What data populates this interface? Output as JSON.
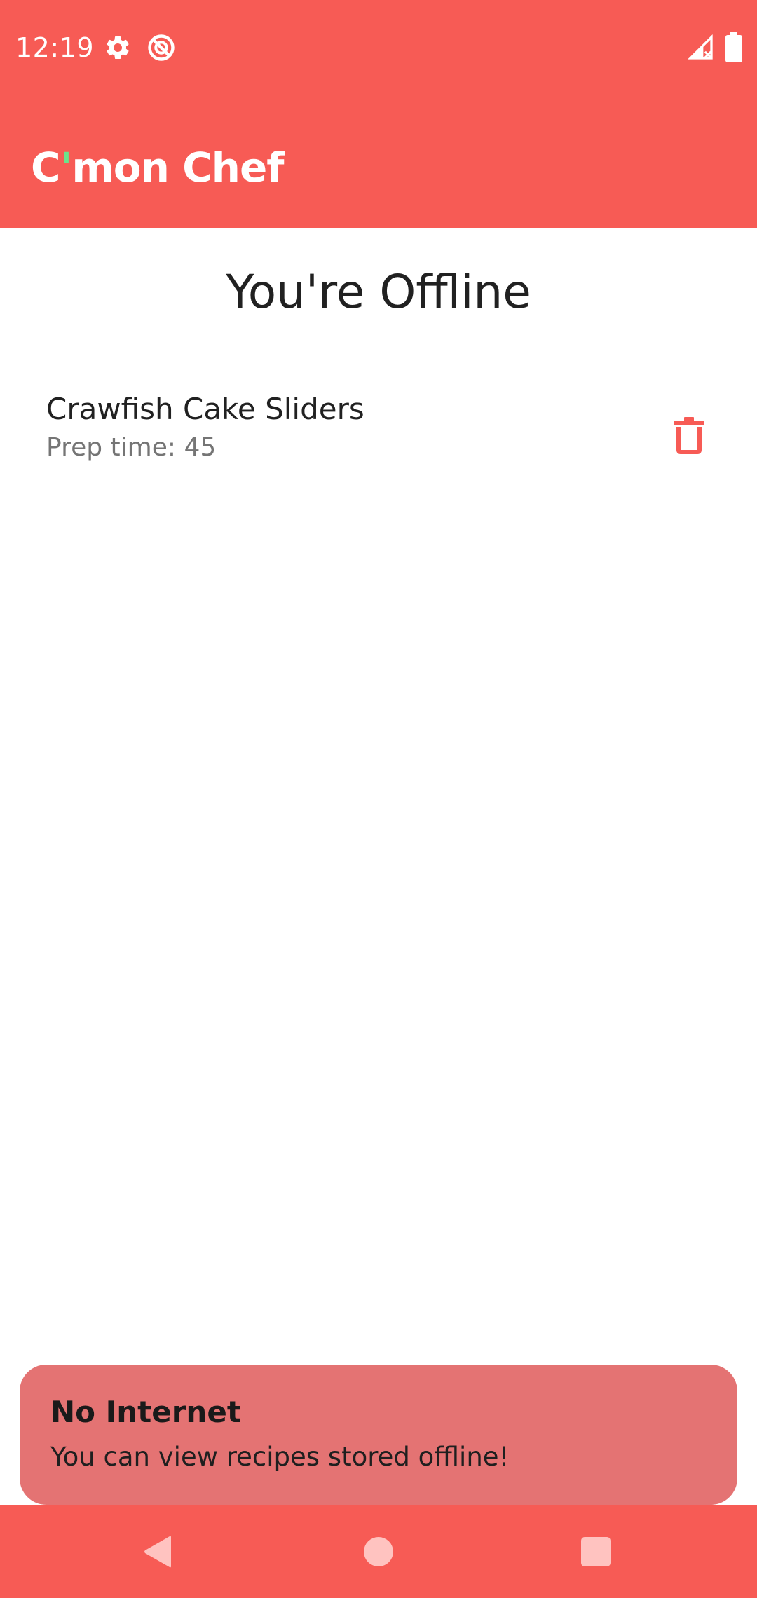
{
  "status_bar": {
    "time": "12:19",
    "icons": [
      "gear-icon",
      "do-not-disturb-icon",
      "signal-no-connection-icon",
      "battery-icon"
    ]
  },
  "app_bar": {
    "title_before": "C",
    "title_apostrophe": "'",
    "title_after": "mon Chef"
  },
  "main": {
    "heading": "You're Offline",
    "recipes": [
      {
        "name": "Crawfish Cake Sliders",
        "prep_label": "Prep time: ",
        "prep_value": "45",
        "action_icon": "trash-icon"
      }
    ]
  },
  "snackbar": {
    "title": "No Internet",
    "message": "You can view recipes stored offline!"
  },
  "nav_bar": {
    "buttons": [
      "back-icon",
      "home-icon",
      "recents-icon"
    ]
  },
  "colors": {
    "primary": "#F75B55",
    "accent": "#6BE38B",
    "snackbar": "#E47373",
    "text_primary": "#212121",
    "text_secondary": "#757575"
  }
}
